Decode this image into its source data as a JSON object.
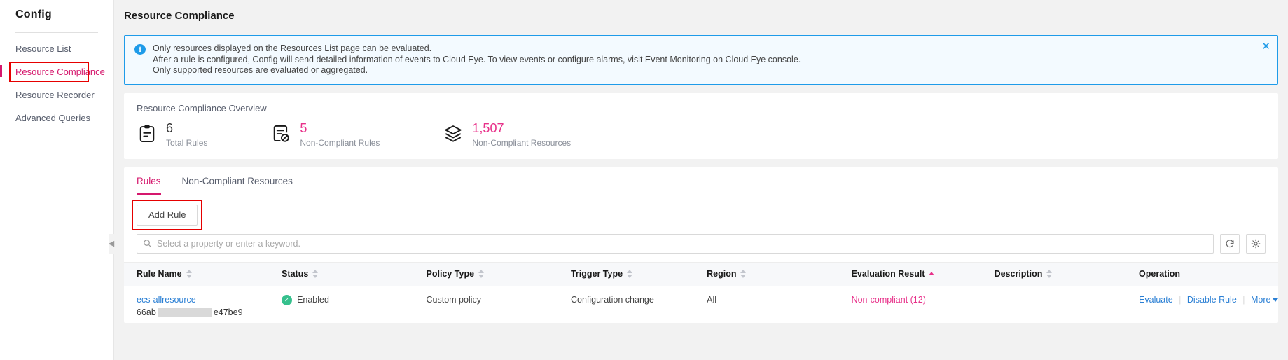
{
  "sidebar": {
    "title": "Config",
    "items": [
      {
        "label": "Resource List",
        "active": false
      },
      {
        "label": "Resource Compliance",
        "active": true
      },
      {
        "label": "Resource Recorder",
        "active": false
      },
      {
        "label": "Advanced Queries",
        "active": false
      }
    ]
  },
  "page": {
    "title": "Resource Compliance"
  },
  "banner": {
    "icon": "info-icon",
    "line1": "Only resources displayed on the Resources List page can be evaluated.",
    "line2": "After a rule is configured, Config will send detailed information of events to Cloud Eye. To view events or configure alarms, visit Event Monitoring on Cloud Eye console.",
    "line3": "Only supported resources are evaluated or aggregated.",
    "close": "✕",
    "border_color": "#1e9be9",
    "background_color": "#f3faff"
  },
  "overview": {
    "title": "Resource Compliance Overview",
    "stats": [
      {
        "icon": "clipboard-rules-icon",
        "value": "6",
        "label": "Total Rules",
        "pink": false
      },
      {
        "icon": "document-blocked-icon",
        "value": "5",
        "label": "Non-Compliant Rules",
        "pink": true
      },
      {
        "icon": "layers-stack-icon",
        "value": "1,507",
        "label": "Non-Compliant Resources",
        "pink": true
      }
    ]
  },
  "tabs": [
    {
      "label": "Rules",
      "active": true
    },
    {
      "label": "Non-Compliant Resources",
      "active": false
    }
  ],
  "toolbar": {
    "add_rule_label": "Add Rule",
    "search_placeholder": "Select a property or enter a keyword.",
    "search_value": "",
    "refresh_icon": "refresh-icon",
    "settings_icon": "gear-icon"
  },
  "table": {
    "columns": [
      {
        "label": "Rule Name",
        "sortable": true,
        "sorted": "none",
        "dashed": false
      },
      {
        "label": "Status",
        "sortable": true,
        "sorted": "none",
        "dashed": true
      },
      {
        "label": "Policy Type",
        "sortable": true,
        "sorted": "none",
        "dashed": false
      },
      {
        "label": "Trigger Type",
        "sortable": true,
        "sorted": "none",
        "dashed": false
      },
      {
        "label": "Region",
        "sortable": true,
        "sorted": "none",
        "dashed": false
      },
      {
        "label": "Evaluation Result",
        "sortable": true,
        "sorted": "asc",
        "dashed": true
      },
      {
        "label": "Description",
        "sortable": true,
        "sorted": "none",
        "dashed": false
      },
      {
        "label": "Operation",
        "sortable": false,
        "sorted": "none",
        "dashed": false
      }
    ],
    "rows": [
      {
        "rule_name": "ecs-allresource",
        "rule_id_prefix": "66ab",
        "rule_id_suffix": "e47be9",
        "status": "Enabled",
        "policy_type": "Custom policy",
        "trigger_type": "Configuration change",
        "region": "All",
        "evaluation_result": "Non-compliant (12)",
        "description": "--",
        "operations": [
          "Evaluate",
          "Disable Rule",
          "More"
        ]
      }
    ]
  },
  "colors": {
    "accent": "#d5186d",
    "pink": "#e8318a",
    "link": "#2a7fd4",
    "success": "#36c08d",
    "annotation": "#e60000"
  }
}
